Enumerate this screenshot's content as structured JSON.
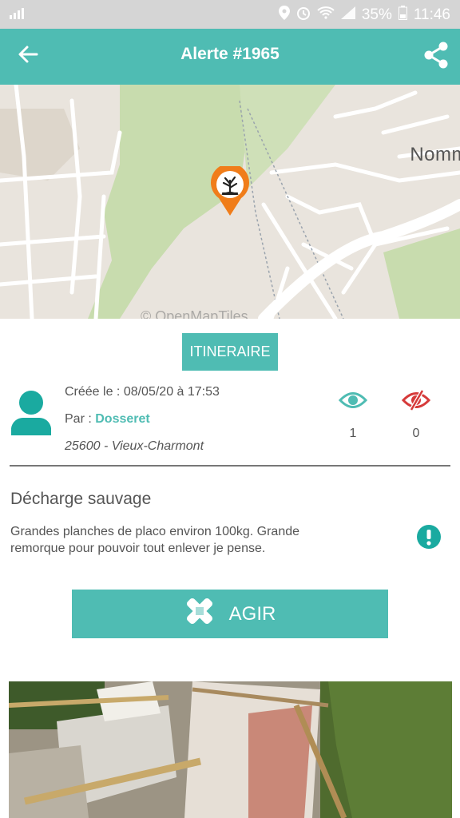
{
  "status_bar": {
    "battery": "35%",
    "time": "11:46"
  },
  "header": {
    "title": "Alerte #1965"
  },
  "map": {
    "town_label": "Nomm",
    "attribution": "© OpenMapTiles"
  },
  "actions": {
    "itinerary_label": "ITINERAIRE",
    "agir_label": "AGIR"
  },
  "alert": {
    "created": "Créée le : 08/05/20 à 17:53",
    "author_prefix": "Par : ",
    "author_name": "Dosseret",
    "location": "25600 - Vieux-Charmont",
    "seen_count": "1",
    "unseen_count": "0",
    "title": "Décharge sauvage",
    "description": "Grandes planches de placo environ 100kg. Grande remorque pour pouvoir tout enlever je pense."
  },
  "colors": {
    "accent": "#4fbcb3",
    "marker": "#f07d1a",
    "danger": "#d63a3a"
  }
}
